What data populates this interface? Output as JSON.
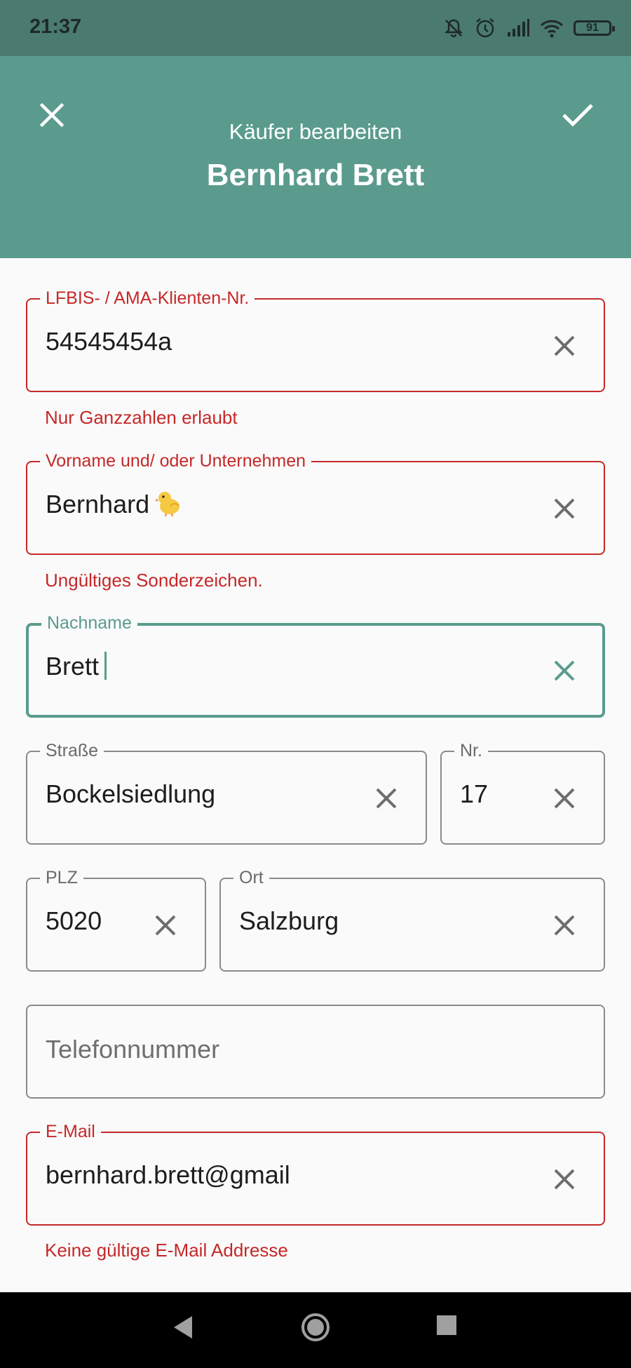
{
  "status_bar": {
    "time": "21:37",
    "battery": "91"
  },
  "app_bar": {
    "subtitle": "Käufer  bearbeiten",
    "title": "Bernhard Brett"
  },
  "form": {
    "client_nr": {
      "label": "LFBIS- / AMA-Klienten-Nr.",
      "value": "54545454a",
      "error": "Nur Ganzzahlen erlaubt"
    },
    "first_name": {
      "label": "Vorname und/ oder Unternehmen",
      "value": "Bernhard",
      "error": "Ungültiges Sonderzeichen."
    },
    "last_name": {
      "label": "Nachname",
      "value": "Brett"
    },
    "street": {
      "label": "Straße",
      "value": "Bockelsiedlung"
    },
    "number": {
      "label": "Nr.",
      "value": "17"
    },
    "zip": {
      "label": "PLZ",
      "value": "5020"
    },
    "city": {
      "label": "Ort",
      "value": "Salzburg"
    },
    "phone": {
      "placeholder": "Telefonnummer"
    },
    "email": {
      "label": "E-Mail",
      "value": "bernhard.brett@gmail",
      "error": "Keine gültige E-Mail Addresse"
    }
  },
  "colors": {
    "accent": "#5a9b8d",
    "error": "#c62828",
    "statusbar": "#4a7a70"
  },
  "icons": [
    "close-icon",
    "check-icon",
    "clear-icon",
    "chick-emoji",
    "back-icon",
    "home-icon",
    "recents-icon"
  ]
}
